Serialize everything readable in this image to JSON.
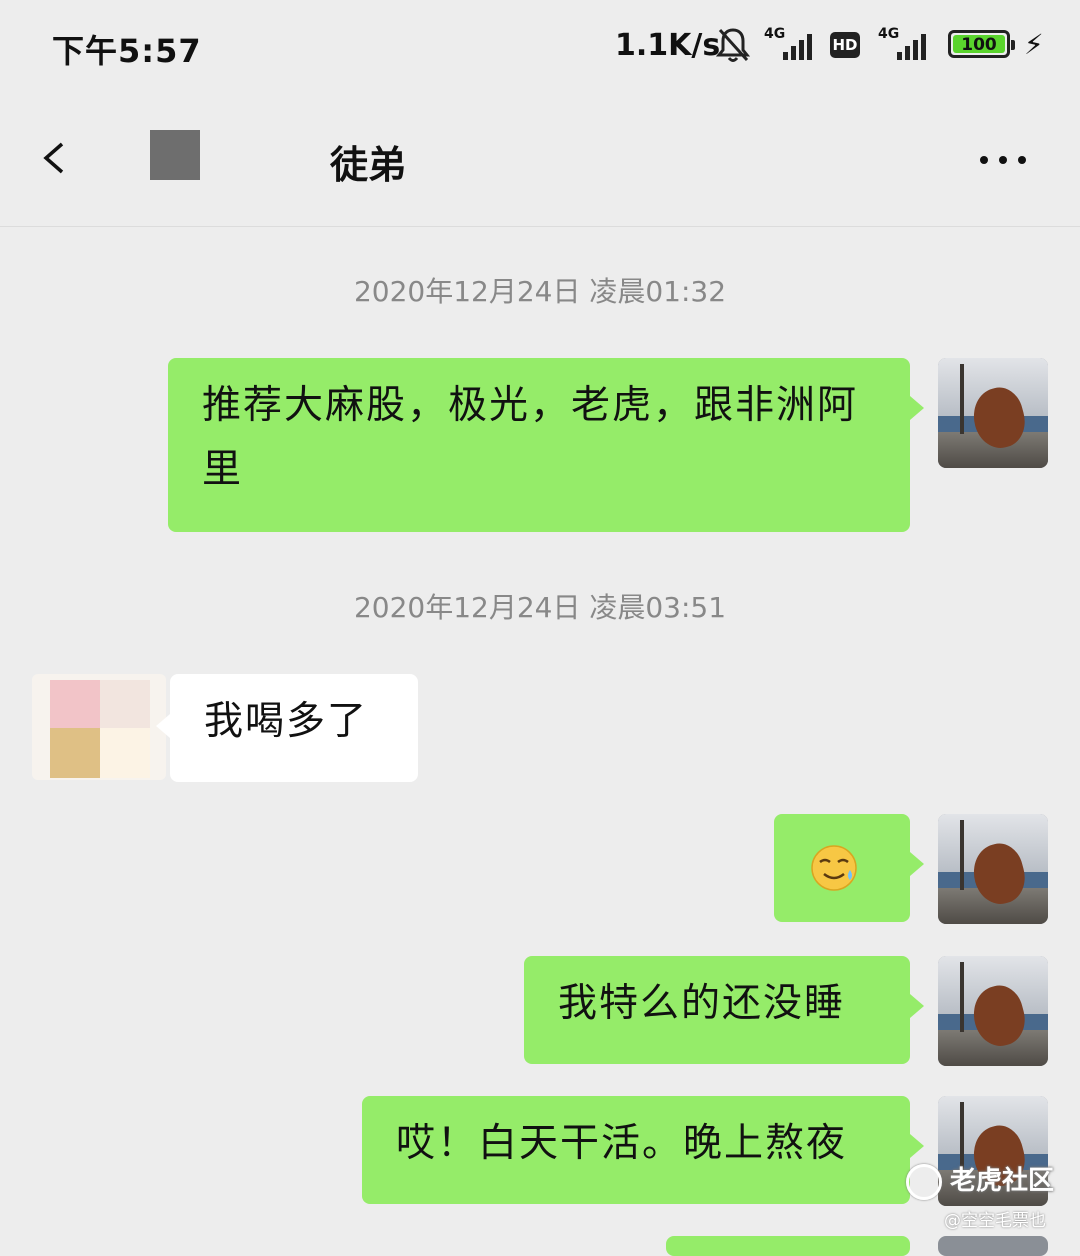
{
  "status_bar": {
    "time": "下午5:57",
    "net_speed": "1.1K/s",
    "sim1_tag": "4G",
    "sim2_tag": "4G",
    "hd_label": "HD",
    "battery": "100",
    "icons": [
      "bell-muted-icon",
      "signal-icon",
      "hd-icon",
      "signal-icon",
      "battery-icon",
      "charging-icon"
    ]
  },
  "nav": {
    "title": "徒弟",
    "back_icon": "chevron-left-icon",
    "more_icon": "more-icon"
  },
  "messages": [
    {
      "type": "timestamp",
      "text": "2020年12月24日 凌晨01:32"
    },
    {
      "type": "sent",
      "text": "推荐大麻股，极光，老虎，跟非洲阿里"
    },
    {
      "type": "timestamp",
      "text": "2020年12月24日 凌晨03:51"
    },
    {
      "type": "received",
      "text": "我喝多了"
    },
    {
      "type": "sent",
      "emoji": "sweat-smile-emoji"
    },
    {
      "type": "sent",
      "text": "我特么的还没睡"
    },
    {
      "type": "sent",
      "text": "哎！白天干活。晚上熬夜"
    }
  ],
  "watermark": {
    "brand": "老虎社区",
    "handle": "@空空毛票也"
  },
  "colors": {
    "background": "#ededed",
    "sent_bubble": "#95ec69",
    "received_bubble": "#ffffff",
    "timestamp_text": "#888888"
  }
}
